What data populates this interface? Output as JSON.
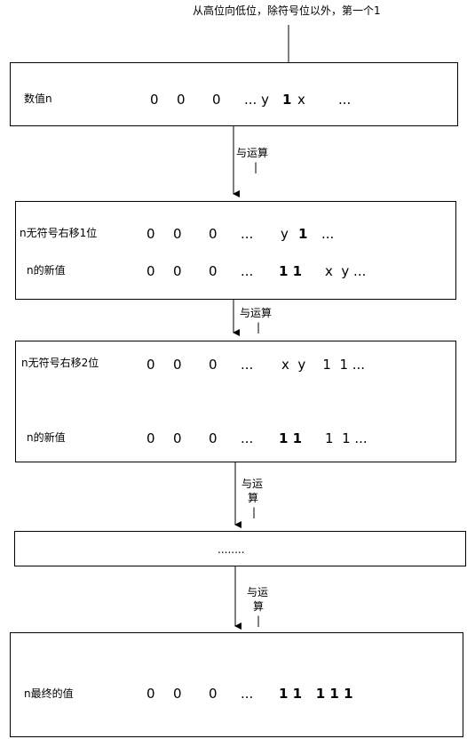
{
  "top_note": "从高位向低位，除符号位以外，第一个1",
  "box1": {
    "label": "数值n",
    "z1": "0",
    "z2": "0",
    "z3": "0",
    "dots_y": "... y",
    "one": "1",
    "x": "x",
    "tail": "..."
  },
  "op1": {
    "line1": "与运算",
    "line2": "|"
  },
  "box2": {
    "row1_label": "n无符号右移1位",
    "row1_z1": "0",
    "row1_z2": "0",
    "row1_z3": "0",
    "row1_dots": "...",
    "row1_y": "y",
    "row1_one": "1",
    "row1_tail": "...",
    "row2_label": "n的新值",
    "row2_z1": "0",
    "row2_z2": "0",
    "row2_z3": "0",
    "row2_dots": "...",
    "row2_ones": "1 1",
    "row2_tail": "x  y ..."
  },
  "op2": {
    "line1": "与运算",
    "line2": "|"
  },
  "box3": {
    "row1_label": "n无符号右移2位",
    "row1_z1": "0",
    "row1_z2": "0",
    "row1_z3": "0",
    "row1_dots": "...",
    "row1_tail": "x  y    1  1 ...",
    "row2_label": "n的新值",
    "row2_z1": "0",
    "row2_z2": "0",
    "row2_z3": "0",
    "row2_dots": "...",
    "row2_ones": "1 1",
    "row2_tail": "1  1 ..."
  },
  "op3": {
    "line1": "与运",
    "line2": "算",
    "line3": "|"
  },
  "box4": {
    "text": "........"
  },
  "op4": {
    "line1": "与运",
    "line2": "算",
    "line3": "|"
  },
  "box5": {
    "label": "n最终的值",
    "z1": "0",
    "z2": "0",
    "z3": "0",
    "dots": "...",
    "ones": "1 1   1 1 1"
  }
}
